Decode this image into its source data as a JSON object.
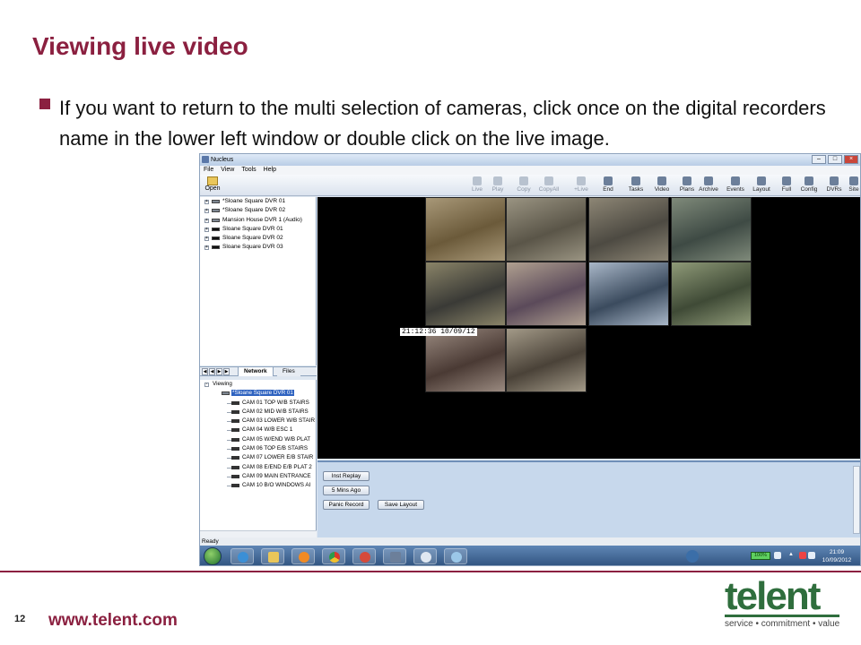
{
  "slide": {
    "title": "Viewing live video",
    "bullet": "If you want to return to the multi selection of cameras, click once on the digital recorders name in the lower left window or double click on the live image.",
    "page_number": "12",
    "footer_url": "www.telent.com",
    "logo_word": "telent",
    "logo_tagline": "service • commitment • value",
    "accent_color": "#8b2040",
    "logo_color": "#2f6e3d"
  },
  "app": {
    "window_title": "Nucleus",
    "menu": [
      "File",
      "View",
      "Tools",
      "Help"
    ],
    "toolbar": {
      "open_label": "Open",
      "buttons": [
        {
          "label": "Live",
          "enabled": false
        },
        {
          "label": "Play",
          "enabled": false
        },
        {
          "label": "Copy",
          "enabled": false
        },
        {
          "label": "CopyAll",
          "enabled": false
        },
        {
          "label": "+Live",
          "enabled": false
        },
        {
          "label": "End",
          "enabled": true
        },
        {
          "label": "Tasks",
          "enabled": true
        },
        {
          "label": "Video",
          "enabled": true
        },
        {
          "label": "Plans",
          "enabled": true
        },
        {
          "label": "Archive",
          "enabled": true
        },
        {
          "label": "Events",
          "enabled": true
        },
        {
          "label": "Layout",
          "enabled": true
        },
        {
          "label": "Full",
          "enabled": true
        },
        {
          "label": "Config",
          "enabled": true
        },
        {
          "label": "DVRs",
          "enabled": true
        },
        {
          "label": "Site",
          "enabled": true
        }
      ]
    },
    "network_tree": [
      {
        "label": "*Sloane Square DVR 01",
        "icon": "dvr-grey"
      },
      {
        "label": "*Sloane Square DVR 02",
        "icon": "dvr-grey"
      },
      {
        "label": "Mansion House DVR 1 (Audio)",
        "icon": "dvr-grey"
      },
      {
        "label": "Sloane Square DVR 01",
        "icon": "dvr-black"
      },
      {
        "label": "Sloane Square DVR 02",
        "icon": "dvr-black"
      },
      {
        "label": "Sloane Square DVR 03",
        "icon": "dvr-black"
      }
    ],
    "tabs": {
      "active": "Network",
      "other": "Files"
    },
    "viewing_tree": {
      "root": "Viewing",
      "recorder": "*Sloane Square DVR 01",
      "cameras": [
        "CAM 01 TOP W/B STAIRS",
        "CAM 02 MID W/B STAIRS",
        "CAM 03 LOWER W/B STAIR",
        "CAM 04 W/B ESC 1",
        "CAM 05 W/END W/B PLAT",
        "CAM 06 TOP E/B STAIRS",
        "CAM 07 LOWER E/B STAIR",
        "CAM 08 E/END E/B PLAT 2",
        "CAM 09 MAIN ENTRANCE",
        "CAM 10 B/O WINDOWS AI"
      ]
    },
    "video_timestamp": "21:12:36 10/09/12",
    "controls": {
      "inst_replay": "Inst Replay",
      "five_mins_ago": "5 Mins Ago",
      "panic_record": "Panic Record",
      "save_layout": "Save Layout"
    },
    "status": "Ready",
    "taskbar": {
      "battery": "100%",
      "time": "21:09",
      "date": "10/09/2012"
    }
  }
}
